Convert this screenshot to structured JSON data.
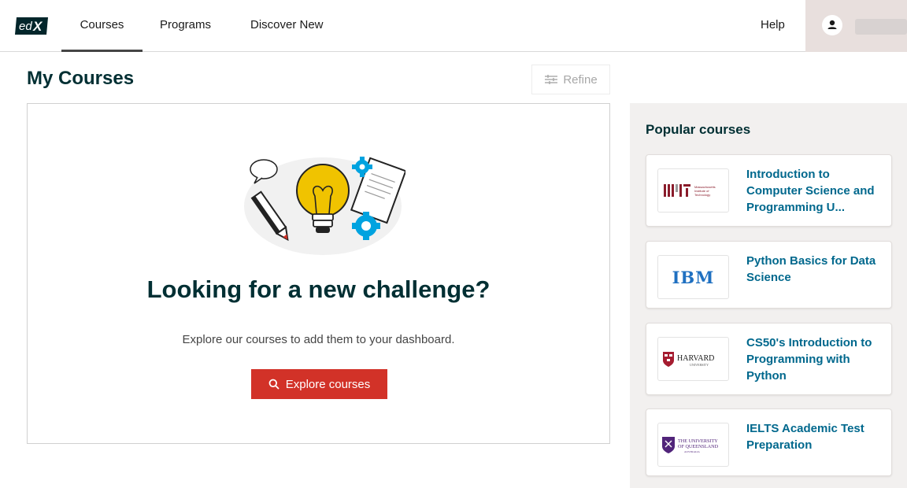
{
  "header": {
    "logo_text": "edX",
    "nav": [
      {
        "label": "Courses",
        "active": true
      },
      {
        "label": "Programs",
        "active": false
      },
      {
        "label": "Discover New",
        "active": false
      }
    ],
    "help_label": "Help"
  },
  "main": {
    "title": "My Courses",
    "refine_label": "Refine",
    "empty_state": {
      "heading": "Looking for a new challenge?",
      "subtext": "Explore our courses to add them to your dashboard.",
      "button_label": "Explore courses"
    }
  },
  "sidebar": {
    "title": "Popular courses",
    "courses": [
      {
        "title": "Introduction to Computer Science and Programming U...",
        "org_logo": "MIT",
        "org_logo_text": [
          "Massachusetts",
          "Institute of",
          "Technology"
        ]
      },
      {
        "title": "Python Basics for Data Science",
        "org_logo": "IBM"
      },
      {
        "title": "CS50's Introduction to Programming with Python",
        "org_logo": "HARVARD",
        "org_logo_sub": "UNIVERSITY"
      },
      {
        "title": "IELTS Academic Test Preparation",
        "org_logo": "The University of Queensland",
        "org_logo_text": [
          "THE UNIVERSITY",
          "OF QUEENSLAND",
          "AUSTRALIA"
        ]
      }
    ]
  },
  "colors": {
    "brand_red": "#d23228",
    "title_dark": "#002f33",
    "link_blue": "#00688d",
    "sidebar_bg": "#f2f0ef"
  }
}
